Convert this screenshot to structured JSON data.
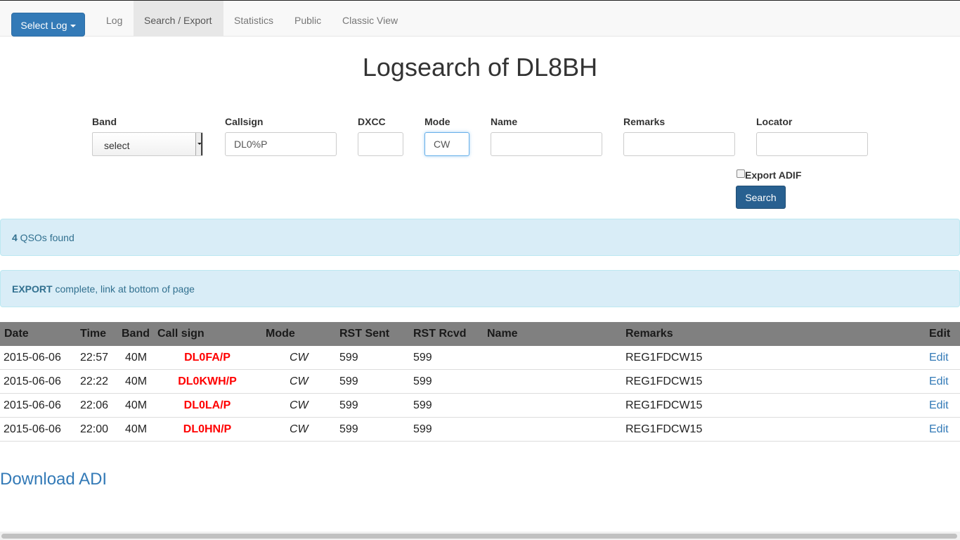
{
  "navbar": {
    "select_log_label": "Select Log",
    "items": [
      "Log",
      "Search / Export",
      "Statistics",
      "Public",
      "Classic View"
    ],
    "active_index": 1
  },
  "page_title": "Logsearch of DL8BH",
  "form": {
    "band_label": "Band",
    "band_value": "select",
    "callsign_label": "Callsign",
    "callsign_value": "DL0%P",
    "dxcc_label": "DXCC",
    "dxcc_value": "",
    "mode_label": "Mode",
    "mode_value": "CW",
    "name_label": "Name",
    "name_value": "",
    "remarks_label": "Remarks",
    "remarks_value": "",
    "locator_label": "Locator",
    "locator_value": "",
    "export_label": "Export ADIF",
    "export_checked": false,
    "search_label": "Search"
  },
  "alerts": {
    "count": "4",
    "count_text": " QSOs found",
    "export_strong": "EXPORT",
    "export_text": " complete, link at bottom of page"
  },
  "table": {
    "headers": [
      "Date",
      "Time",
      "Band",
      "Call sign",
      "Mode",
      "RST Sent",
      "RST Rcvd",
      "Name",
      "Remarks",
      "Edit"
    ],
    "rows": [
      {
        "date": "2015-06-06",
        "time": "22:57",
        "band": "40M",
        "call": "DL0FA/P",
        "mode": "CW",
        "rst_sent": "599",
        "rst_rcvd": "599",
        "name": "",
        "remarks": "REG1FDCW15",
        "edit": "Edit"
      },
      {
        "date": "2015-06-06",
        "time": "22:22",
        "band": "40M",
        "call": "DL0KWH/P",
        "mode": "CW",
        "rst_sent": "599",
        "rst_rcvd": "599",
        "name": "",
        "remarks": "REG1FDCW15",
        "edit": "Edit"
      },
      {
        "date": "2015-06-06",
        "time": "22:06",
        "band": "40M",
        "call": "DL0LA/P",
        "mode": "CW",
        "rst_sent": "599",
        "rst_rcvd": "599",
        "name": "",
        "remarks": "REG1FDCW15",
        "edit": "Edit"
      },
      {
        "date": "2015-06-06",
        "time": "22:00",
        "band": "40M",
        "call": "DL0HN/P",
        "mode": "CW",
        "rst_sent": "599",
        "rst_rcvd": "599",
        "name": "",
        "remarks": "REG1FDCW15",
        "edit": "Edit"
      }
    ]
  },
  "download_label": "Download ADI",
  "colors": {
    "primary": "#337ab7",
    "callsign": "#ff0000",
    "alert_bg": "#d9edf7",
    "table_header_bg": "#808080"
  }
}
